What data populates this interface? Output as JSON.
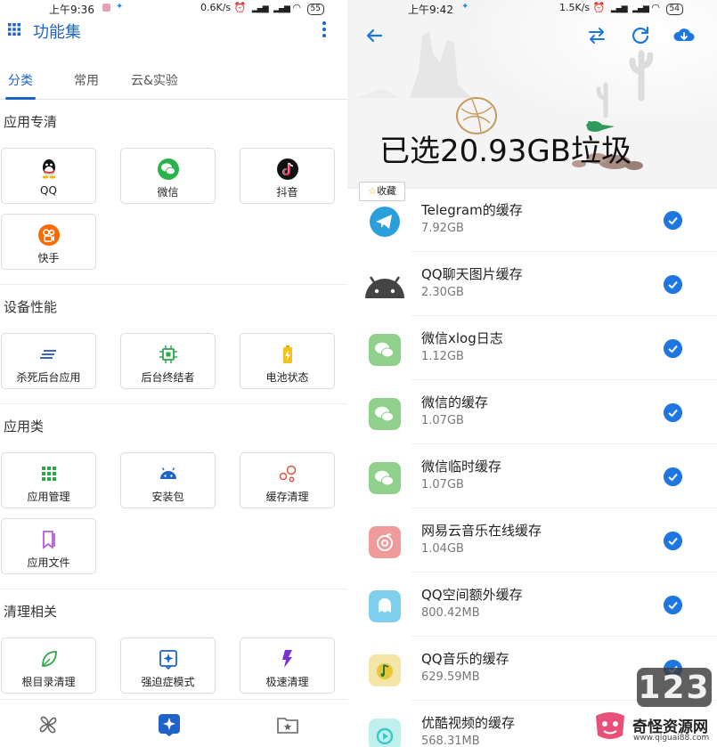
{
  "left": {
    "status": {
      "time": "上午9:36",
      "speed": "0.6K/s",
      "battery": "55"
    },
    "appbar": {
      "title": "功能集",
      "grid_icon": "grid-icon",
      "more_icon": "more-vert-icon"
    },
    "tabs": [
      {
        "label": "分类",
        "active": true
      },
      {
        "label": "常用",
        "active": false
      },
      {
        "label": "云&实验",
        "active": false
      }
    ],
    "sections": [
      {
        "title": "应用专清",
        "items": [
          {
            "label": "QQ",
            "icon": "qq-icon"
          },
          {
            "label": "微信",
            "icon": "wechat-icon"
          },
          {
            "label": "抖音",
            "icon": "douyin-icon"
          },
          {
            "label": "快手",
            "icon": "kuaishou-icon"
          }
        ]
      },
      {
        "title": "设备性能",
        "items": [
          {
            "label": "杀死后台应用",
            "icon": "kill-app-icon"
          },
          {
            "label": "后台终结者",
            "icon": "chip-icon"
          },
          {
            "label": "电池状态",
            "icon": "battery-icon"
          }
        ]
      },
      {
        "title": "应用类",
        "items": [
          {
            "label": "应用管理",
            "icon": "app-grid-icon"
          },
          {
            "label": "安装包",
            "icon": "android-icon"
          },
          {
            "label": "缓存清理",
            "icon": "cache-bubbles-icon"
          },
          {
            "label": "应用文件",
            "icon": "bookmark-icon"
          }
        ]
      },
      {
        "title": "清理相关",
        "items": [
          {
            "label": "根目录清理",
            "icon": "leaf-icon"
          },
          {
            "label": "强迫症模式",
            "icon": "sparkle-icon"
          },
          {
            "label": "极速清理",
            "icon": "lightning-icon"
          }
        ]
      }
    ],
    "bottom_nav": [
      {
        "name": "fan-icon"
      },
      {
        "name": "sparkle-nav-icon"
      },
      {
        "name": "folder-star-icon"
      }
    ]
  },
  "right": {
    "status": {
      "time": "上午9:42",
      "speed": "1.5K/s",
      "battery": "54"
    },
    "hero": {
      "title": "已选20.93GB垃圾"
    },
    "favorite_badge": {
      "label": "收藏"
    },
    "items": [
      {
        "name": "Telegram的缓存",
        "size": "7.92GB",
        "icon": "telegram-icon",
        "color": "#2a9fd9",
        "checked": true
      },
      {
        "name": "QQ聊天图片缓存",
        "size": "2.30GB",
        "icon": "android-robot-icon",
        "color": "#444444",
        "checked": true
      },
      {
        "name": "微信xlog日志",
        "size": "1.12GB",
        "icon": "wechat-icon",
        "color": "#8fd08c",
        "checked": true
      },
      {
        "name": "微信的缓存",
        "size": "1.07GB",
        "icon": "wechat-icon",
        "color": "#8fd08c",
        "checked": true
      },
      {
        "name": "微信临时缓存",
        "size": "1.07GB",
        "icon": "wechat-icon",
        "color": "#8fd08c",
        "checked": true
      },
      {
        "name": "网易云音乐在线缓存",
        "size": "1.04GB",
        "icon": "netease-music-icon",
        "color": "#f19a9a",
        "checked": true
      },
      {
        "name": "QQ空间额外缓存",
        "size": "800.42MB",
        "icon": "qzone-icon",
        "color": "#7fd0ee",
        "checked": true
      },
      {
        "name": "QQ音乐的缓存",
        "size": "629.59MB",
        "icon": "qq-music-icon",
        "color": "#f4e6a6",
        "checked": true
      },
      {
        "name": "优酷视频的缓存",
        "size": "568.31MB",
        "icon": "youku-icon",
        "color": "#bff0ee",
        "checked": true
      }
    ]
  },
  "watermark": {
    "number": "123",
    "name": "奇怪资源网",
    "url": "www.qiguai88.com"
  }
}
